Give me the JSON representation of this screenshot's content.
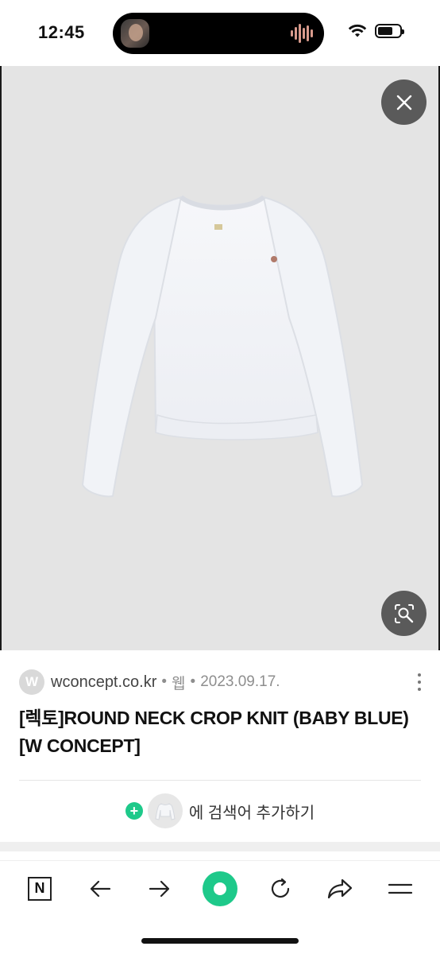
{
  "status_bar": {
    "time": "12:45"
  },
  "image_viewer": {
    "close_icon": "close-icon",
    "lens_icon": "image-search-icon"
  },
  "result": {
    "source_initial": "W",
    "source_name": "wconcept.co.kr",
    "separator1": "•",
    "type": "웹",
    "separator2": "•",
    "date": "2023.09.17.",
    "title": "[렉토]ROUND NECK CROP KNIT (BABY BLUE) [W CONCEPT]",
    "add_search_label": "에 검색어 추가하기",
    "add_icon": "+"
  },
  "toolbar": {
    "home_label": "N",
    "back_icon": "arrow-left-icon",
    "forward_icon": "arrow-right-icon",
    "green_icon": "green-dot-icon",
    "refresh_icon": "refresh-icon",
    "share_icon": "share-icon",
    "menu_icon": "menu-icon"
  },
  "colors": {
    "accent_green": "#1ec98a",
    "image_bg": "#e4e4e4",
    "overlay_button": "#5a5a5a"
  }
}
